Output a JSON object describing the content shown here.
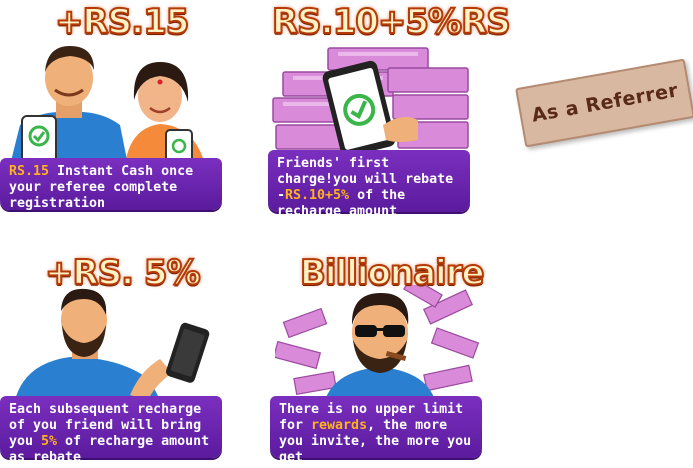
{
  "cards": [
    {
      "headline": "+RS.15",
      "desc": [
        {
          "t": "RS.15",
          "hl": true
        },
        {
          "t": " Instant Cash once your referee complete registration",
          "hl": false
        }
      ]
    },
    {
      "headline": "RS.10+5%RS",
      "desc": [
        {
          "t": "Friends' first charge!you will rebate -",
          "hl": false
        },
        {
          "t": "RS.10+5%",
          "hl": true
        },
        {
          "t": " of the recharge amount",
          "hl": false
        }
      ]
    },
    {
      "headline": "+RS. 5%",
      "desc": [
        {
          "t": "Each subsequent recharge of you friend will bring you ",
          "hl": false
        },
        {
          "t": "5%",
          "hl": true
        },
        {
          "t": " of recharge amount as rebate",
          "hl": false
        }
      ]
    },
    {
      "headline": "Billionaire",
      "desc": [
        {
          "t": "There is no upper limit for ",
          "hl": false
        },
        {
          "t": "rewards",
          "hl": true
        },
        {
          "t": ", the more you invite, the more you get",
          "hl": false
        }
      ]
    }
  ],
  "stamp": {
    "label": "As a Referrer"
  },
  "colors": {
    "panel": "#6a25b0",
    "highlight": "#ffb21a",
    "headline_fill": "#fff3c6",
    "headline_stroke": "#b43a08"
  }
}
